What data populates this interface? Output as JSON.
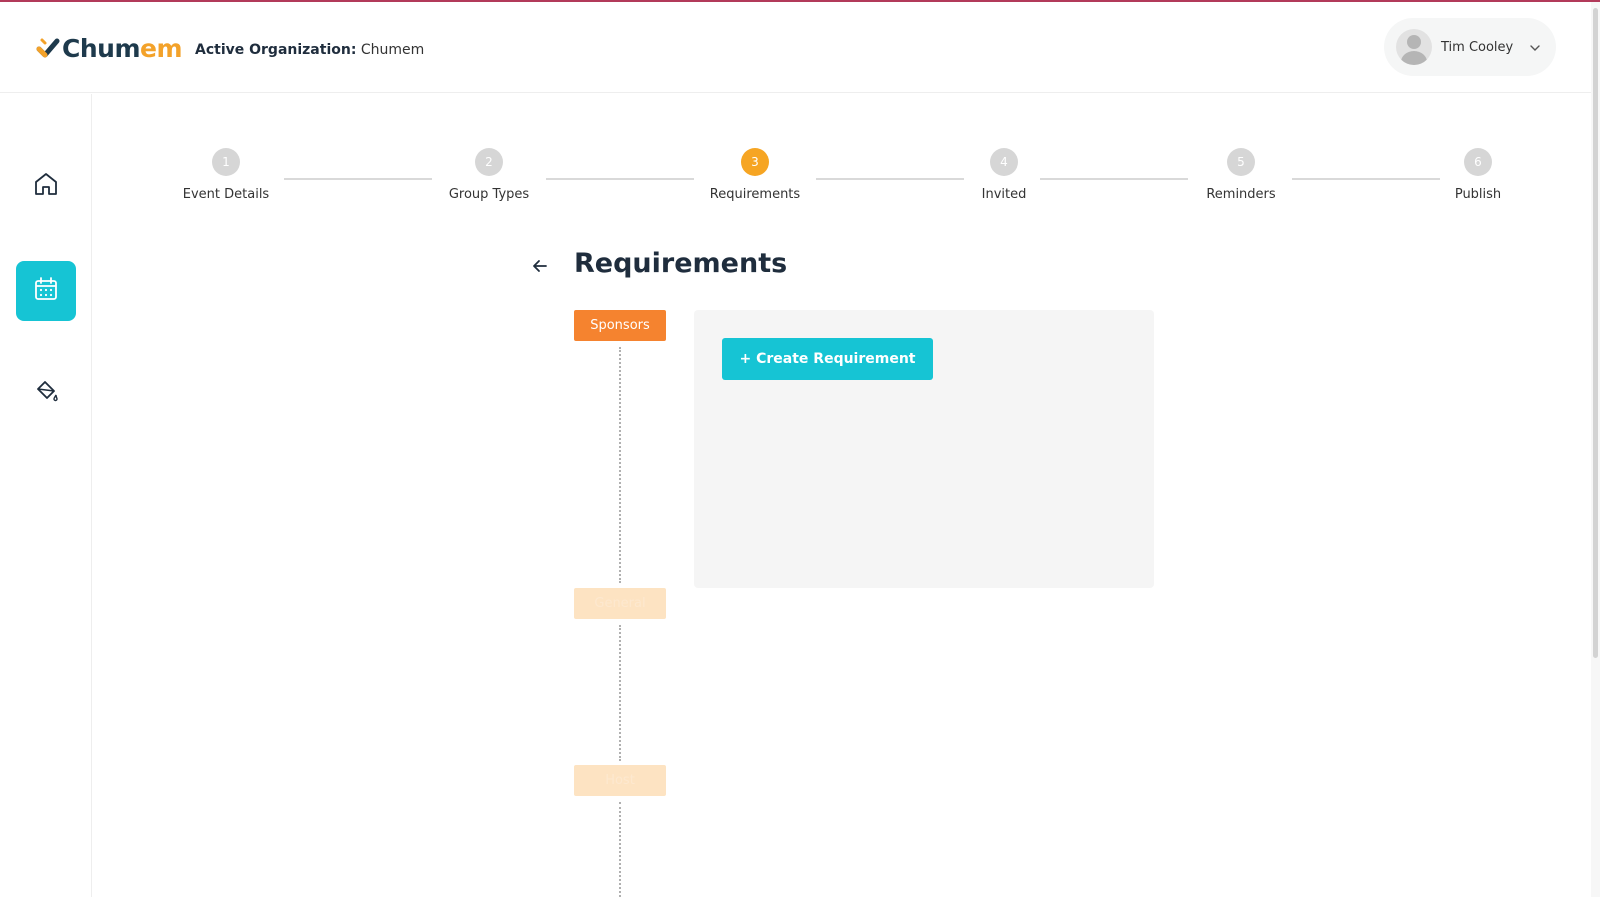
{
  "app": {
    "logo_part1": "Chum",
    "logo_part2": "em",
    "org_label": "Active Organization:",
    "org_name": "Chumem",
    "colors": {
      "accent": "#16c4d4",
      "brand_orange": "#f5832f",
      "step_active": "#f6a523",
      "logo_dark": "#1e3a4c",
      "logo_yellow": "#f3a22a"
    }
  },
  "user": {
    "name": "Tim Cooley",
    "avatar_icon": "user-avatar-icon",
    "menu_icon": "chevron-down-icon"
  },
  "sidebar": {
    "items": [
      {
        "name": "home",
        "icon": "home-icon",
        "active": false
      },
      {
        "name": "events",
        "icon": "calendar-icon",
        "active": true
      },
      {
        "name": "branding",
        "icon": "paint-bucket-icon",
        "active": false
      }
    ]
  },
  "stepper": {
    "steps": [
      {
        "number": "1",
        "label": "Event Details",
        "active": false
      },
      {
        "number": "2",
        "label": "Group Types",
        "active": false
      },
      {
        "number": "3",
        "label": "Requirements",
        "active": true
      },
      {
        "number": "4",
        "label": "Invited",
        "active": false
      },
      {
        "number": "5",
        "label": "Reminders",
        "active": false
      },
      {
        "number": "6",
        "label": "Publish",
        "active": false
      }
    ]
  },
  "main": {
    "title": "Requirements",
    "back_icon": "arrow-left-icon",
    "timeline": [
      {
        "label": "Sponsors",
        "active": true
      },
      {
        "label": "General",
        "active": false
      },
      {
        "label": "Host",
        "active": false
      }
    ],
    "create_button": "+ Create Requirement"
  }
}
